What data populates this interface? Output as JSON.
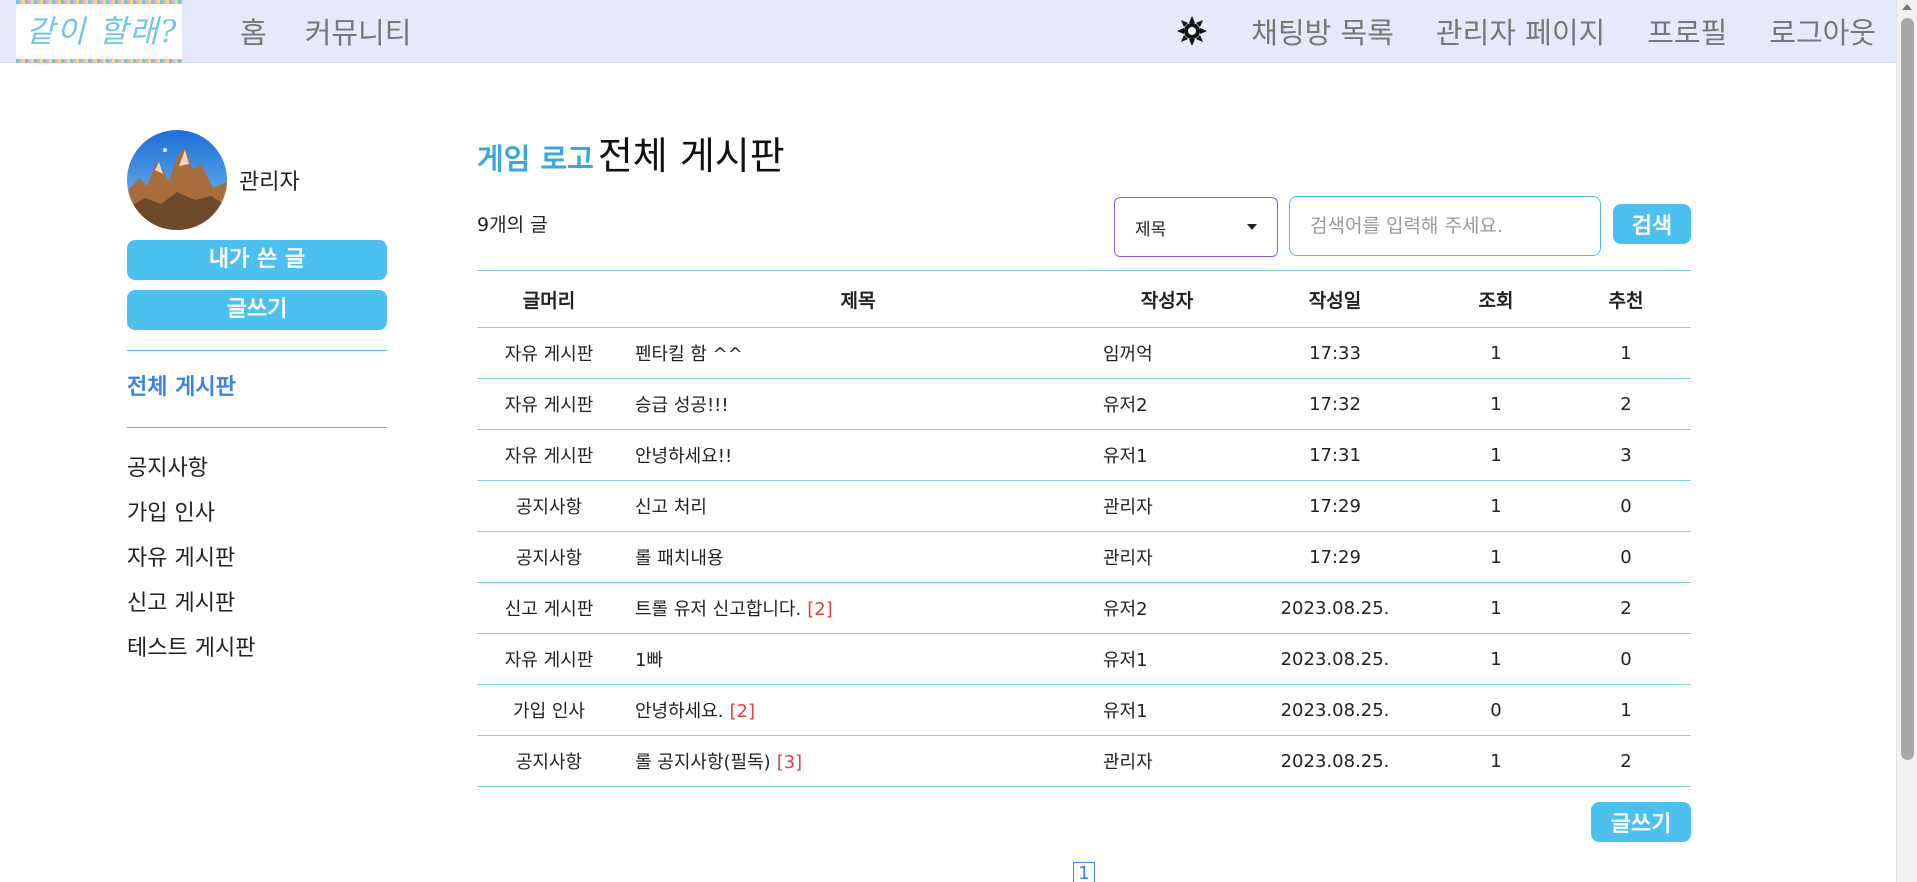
{
  "navbar": {
    "logo_text": "같이 할래?",
    "left_items": [
      "홈",
      "커뮤니티"
    ],
    "right_items": [
      "채팅방 목록",
      "관리자 페이지",
      "프로필",
      "로그아웃"
    ],
    "theme_icon": "gear-sun-icon"
  },
  "sidebar": {
    "profile_name": "관리자",
    "my_posts_button": "내가 쓴 글",
    "write_button": "글쓰기",
    "all_board": "전체 게시판",
    "boards": [
      "공지사항",
      "가입 인사",
      "자유 게시판",
      "신고 게시판",
      "테스트 게시판"
    ]
  },
  "main": {
    "title_accent": "게임 로고",
    "title": "전체 게시판",
    "post_count": "9개의 글",
    "search_type": "제목",
    "search_placeholder": "검색어를 입력해 주세요.",
    "search_button": "검색",
    "columns": [
      "글머리",
      "제목",
      "작성자",
      "작성일",
      "조회",
      "추천"
    ],
    "rows": [
      {
        "category": "자유 게시판",
        "title": "펜타킬 함 ^^",
        "comments": "",
        "author": "임꺼억",
        "date": "17:33",
        "views": "1",
        "recommend": "1"
      },
      {
        "category": "자유 게시판",
        "title": "승급 성공!!!",
        "comments": "",
        "author": "유저2",
        "date": "17:32",
        "views": "1",
        "recommend": "2"
      },
      {
        "category": "자유 게시판",
        "title": "안녕하세요!!",
        "comments": "",
        "author": "유저1",
        "date": "17:31",
        "views": "1",
        "recommend": "3"
      },
      {
        "category": "공지사항",
        "title": "신고 처리",
        "comments": "",
        "author": "관리자",
        "date": "17:29",
        "views": "1",
        "recommend": "0"
      },
      {
        "category": "공지사항",
        "title": "롤 패치내용",
        "comments": "",
        "author": "관리자",
        "date": "17:29",
        "views": "1",
        "recommend": "0"
      },
      {
        "category": "신고 게시판",
        "title": "트롤 유저 신고합니다.",
        "comments": "[2]",
        "author": "유저2",
        "date": "2023.08.25.",
        "views": "1",
        "recommend": "2"
      },
      {
        "category": "자유 게시판",
        "title": "1빠",
        "comments": "",
        "author": "유저1",
        "date": "2023.08.25.",
        "views": "1",
        "recommend": "0"
      },
      {
        "category": "가입 인사",
        "title": "안녕하세요.",
        "comments": "[2]",
        "author": "유저1",
        "date": "2023.08.25.",
        "views": "0",
        "recommend": "1"
      },
      {
        "category": "공지사항",
        "title": "롤 공지사항(필독)",
        "comments": "[3]",
        "author": "관리자",
        "date": "2023.08.25.",
        "views": "1",
        "recommend": "2"
      }
    ],
    "write_button": "글쓰기",
    "current_page": "1"
  },
  "colors": {
    "accent": "#4cc1ef",
    "navbar_bg": "#e6e9fb",
    "link_blue": "#3b82e6",
    "comment_red": "#e53e3e"
  }
}
